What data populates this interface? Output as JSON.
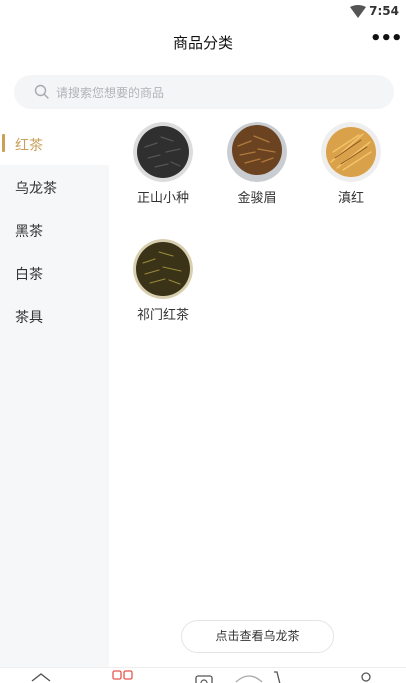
{
  "status_bar": {
    "time": "7:54"
  },
  "header": {
    "title": "商品分类",
    "more_label": "•••"
  },
  "search": {
    "placeholder": "请搜索您想要的商品"
  },
  "sidebar": {
    "items": [
      {
        "label": "红茶",
        "active": true
      },
      {
        "label": "乌龙茶",
        "active": false
      },
      {
        "label": "黑茶",
        "active": false
      },
      {
        "label": "白茶",
        "active": false
      },
      {
        "label": "茶具",
        "active": false
      }
    ]
  },
  "products": [
    {
      "label": "正山小种"
    },
    {
      "label": "金骏眉"
    },
    {
      "label": "滇红"
    },
    {
      "label": "祁门红茶"
    }
  ],
  "next_category_button": "点击查看乌龙茶",
  "colors": {
    "accent": "#c8a05a",
    "sidebar_bg": "#f6f7f9",
    "tab_active": "#e8554e"
  },
  "tabbar": {
    "icons": [
      "home-icon",
      "category-icon",
      "camera-icon",
      "tea-icon",
      "cart-icon",
      "user-icon"
    ]
  }
}
